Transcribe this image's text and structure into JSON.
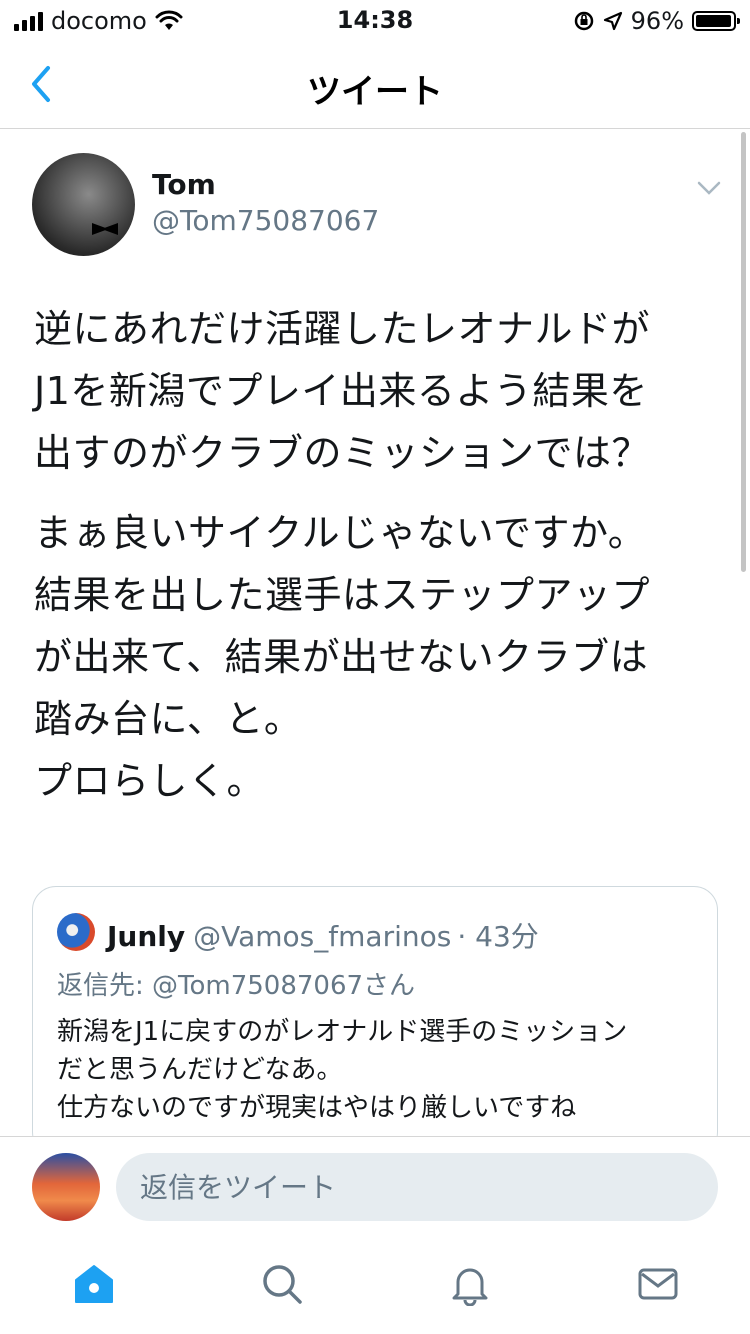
{
  "status_bar": {
    "carrier": "docomo",
    "time": "14:38",
    "battery": "96%",
    "battery_level": 0.96,
    "icons": [
      "signal-icon",
      "wifi-icon",
      "orientation-lock-icon",
      "location-icon",
      "battery-icon"
    ]
  },
  "nav": {
    "title": "ツイート",
    "back_icon": "chevron-left-icon"
  },
  "tweet": {
    "author_name": "Tom",
    "author_handle": "@Tom75087067",
    "paragraph1": "逆にあれだけ活躍したレオナルドが\nJ1を新潟でプレイ出来るよう結果を\n出すのがクラブのミッションでは？",
    "paragraph2": "まぁ良いサイクルじゃないですか。\n結果を出した選手はステップアップ\nが出来て、結果が出せないクラブは\n踏み台に、と。\nプロらしく。"
  },
  "quoted": {
    "name": "Junly",
    "handle": "@Vamos_fmarinos",
    "time": "· 43分",
    "reply_to": "返信先: @Tom75087067さん",
    "text": "新潟をJ1に戻すのがレオナルド選手のミッション\nだと思うんだけどなあ。\n仕方ないのですが現実はやはり厳しいですね"
  },
  "compose": {
    "placeholder": "返信をツイート"
  },
  "tabs": [
    "home-icon",
    "search-icon",
    "notifications-icon",
    "messages-icon"
  ],
  "colors": {
    "accent": "#1da1f2",
    "secondary_text": "#657786",
    "input_bg": "#e6ecf0"
  }
}
